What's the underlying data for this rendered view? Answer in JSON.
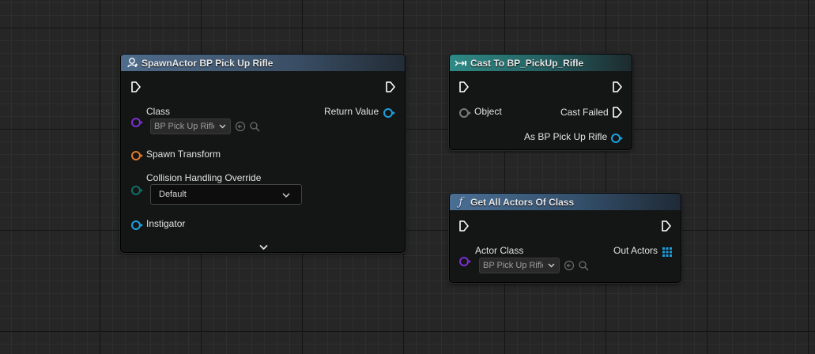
{
  "nodes": {
    "spawn_actor": {
      "title": "SpawnActor BP Pick Up Rifle",
      "header_color": "#4d6a8a",
      "pins": {
        "class_label": "Class",
        "class_value": "BP Pick Up Rifle",
        "return_value": "Return Value",
        "spawn_transform": "Spawn Transform",
        "collision_label": "Collision Handling Override",
        "collision_value": "Default",
        "instigator": "Instigator"
      }
    },
    "cast_to": {
      "title": "Cast To BP_PickUp_Rifle",
      "header_color": "#2a7a7a",
      "pins": {
        "object": "Object",
        "cast_failed": "Cast Failed",
        "as_result": "As BP Pick Up Rifle"
      }
    },
    "get_all_actors": {
      "title": "Get All Actors Of Class",
      "header_color": "#3c5a7a",
      "pins": {
        "actor_class_label": "Actor Class",
        "actor_class_value": "BP Pick Up Rifle",
        "out_actors": "Out Actors"
      }
    }
  },
  "colors": {
    "class_pin": "#7b2fd0",
    "object_pin_blue": "#1d9fe0",
    "struct_pin_orange": "#e0782a",
    "enum_pin_teal": "#0f6e66",
    "exec_pin": "#ffffff"
  },
  "icons": [
    "spawn-actor-icon",
    "cast-icon",
    "function-icon",
    "exec-pin-icon",
    "array-pin-icon",
    "chevron-down-icon",
    "use-selected-icon",
    "browse-icon"
  ]
}
